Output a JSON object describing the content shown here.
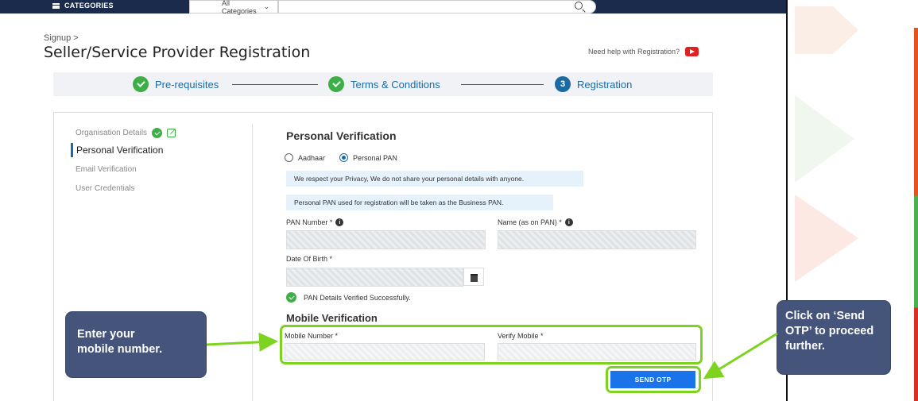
{
  "topbar": {
    "categories_label": "CATEGORIES",
    "category_select": "All Categories"
  },
  "page": {
    "breadcrumb": "Signup >",
    "title": "Seller/Service Provider Registration",
    "help_text": "Need help with Registration?"
  },
  "stepper": {
    "steps": [
      {
        "label": "Pre-requisites",
        "state": "done"
      },
      {
        "label": "Terms & Conditions",
        "state": "done"
      },
      {
        "label": "Registration",
        "state": "current",
        "number": "3"
      }
    ]
  },
  "side_nav": {
    "items": [
      {
        "label": "Organisation Details",
        "state": "done"
      },
      {
        "label": "Personal Verification",
        "state": "active"
      },
      {
        "label": "Email Verification",
        "state": "pending"
      },
      {
        "label": "User Credentials",
        "state": "pending"
      }
    ]
  },
  "personal_verification": {
    "title": "Personal Verification",
    "options": [
      "Aadhaar",
      "Personal PAN"
    ],
    "selected_option": "Personal PAN",
    "privacy_note": "We respect your Privacy, We do not share your personal details with anyone.",
    "pan_note": "Personal PAN used for registration will be taken as the Business PAN.",
    "pan_label": "PAN Number *",
    "name_label": "Name (as on PAN) *",
    "dob_label": "Date Of Birth *",
    "verified_text": "PAN Details Verified Successfully."
  },
  "mobile_verification": {
    "title": "Mobile Verification",
    "mobile_label": "Mobile Number *",
    "verify_label": "Verify Mobile *",
    "send_otp": "SEND OTP"
  },
  "callouts": {
    "left": "Enter your\nmobile number.",
    "right": "Click on ‘Send\nOTP’ to proceed\nfurther."
  },
  "colors": {
    "accent_green": "#7ed321",
    "primary_blue": "#1a73e8",
    "callout_bg": "#44547a",
    "success_green": "#3fae49"
  }
}
